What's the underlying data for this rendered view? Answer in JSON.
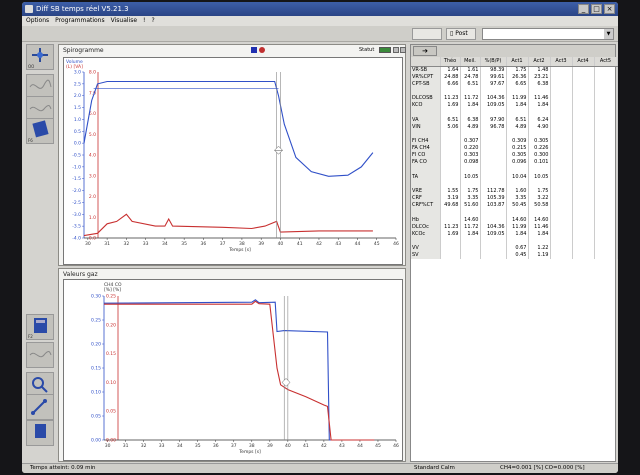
{
  "window": {
    "title": "Diff SB temps réel V5.21.3",
    "menu": [
      "Options",
      "Programmations",
      "Visualise",
      "!",
      "?"
    ],
    "controls": [
      "_",
      "□",
      "×"
    ]
  },
  "toolbar": {
    "tab1": "",
    "tab2": "Post"
  },
  "sidebar": {
    "tools": [
      {
        "label": "OO"
      },
      {
        "label": ""
      },
      {
        "label": ""
      },
      {
        "label": "F6"
      },
      {
        "label": "F2"
      },
      {
        "label": ""
      },
      {
        "label": ""
      },
      {
        "label": ""
      },
      {
        "label": ""
      }
    ]
  },
  "spirogram": {
    "title": "Spirogramme",
    "status_label": "Statut",
    "y_label_1": "Volume",
    "y_label_2": "(L) [VA]",
    "x_label": "Temps [s]",
    "x_ticks": [
      "30",
      "31",
      "32",
      "33",
      "34",
      "35",
      "36",
      "37",
      "38",
      "39",
      "40",
      "41",
      "42",
      "43",
      "44",
      "45",
      "46"
    ],
    "y_ticks_left": [
      "3.0",
      "2.5",
      "2.0",
      "1.5",
      "1.0",
      "0.5",
      "0.0",
      "-0.5",
      "-1.0",
      "-1.5",
      "-2.0",
      "-2.5",
      "-3.0",
      "-3.5",
      "-4.0"
    ],
    "y_ticks_right": [
      "8.0",
      "7.0",
      "6.0",
      "5.0",
      "4.0",
      "3.0",
      "2.0",
      "1.0",
      "0.0"
    ],
    "series": [
      {
        "name": "",
        "color": "#3050c8",
        "points": [
          [
            29.8,
            0
          ],
          [
            30.2,
            1.8
          ],
          [
            30.5,
            2.5
          ],
          [
            31,
            2.6
          ],
          [
            39.7,
            2.6
          ],
          [
            39.9,
            2.0
          ],
          [
            40.2,
            0.8
          ],
          [
            40.8,
            -0.6
          ],
          [
            41.6,
            -1.2
          ],
          [
            42.5,
            -1.4
          ],
          [
            43.5,
            -1.35
          ],
          [
            44.2,
            -1.0
          ],
          [
            44.8,
            -0.4
          ]
        ]
      },
      {
        "name": "",
        "color": "#c83030",
        "points": [
          [
            29.8,
            -3.9
          ],
          [
            30.5,
            -3.8
          ],
          [
            31,
            -3.4
          ],
          [
            31.5,
            -3.3
          ],
          [
            32,
            -3.0
          ],
          [
            32.3,
            -3.3
          ],
          [
            33.5,
            -3.5
          ],
          [
            34,
            -3.5
          ],
          [
            34.2,
            -3.2
          ],
          [
            34.4,
            -3.5
          ],
          [
            37,
            -3.55
          ],
          [
            38.5,
            -3.6
          ],
          [
            39.2,
            -3.5
          ],
          [
            39.8,
            -3.3
          ],
          [
            40,
            -3.75
          ],
          [
            42,
            -3.7
          ],
          [
            44.8,
            -3.7
          ]
        ]
      }
    ],
    "ref_line_value": 2.3
  },
  "gas": {
    "title": "Valeurs gaz",
    "legend_1": "CH4  CO",
    "legend_2": "[%]  [%]",
    "x_label": "Temps [s]",
    "x_ticks": [
      "30",
      "31",
      "32",
      "33",
      "34",
      "35",
      "36",
      "37",
      "38",
      "39",
      "40",
      "41",
      "42",
      "43",
      "44",
      "45",
      "46"
    ],
    "y_ticks_left": [
      "0.30",
      "0.25",
      "0.20",
      "0.15",
      "0.10",
      "0.05",
      "0.00"
    ],
    "y_ticks_right": [
      "0.25",
      "0.20",
      "0.15",
      "0.10",
      "0.05",
      "0.00"
    ],
    "series": [
      {
        "name": "CH4",
        "color": "#3050c8",
        "points": [
          [
            29.8,
            0.285
          ],
          [
            38,
            0.287
          ],
          [
            38.2,
            0.292
          ],
          [
            38.4,
            0.286
          ],
          [
            39.3,
            0.287
          ],
          [
            39.4,
            0.226
          ],
          [
            39.8,
            0.228
          ],
          [
            42.2,
            0.225
          ],
          [
            42.3,
            0.0
          ],
          [
            44.8,
            0.0
          ]
        ]
      },
      {
        "name": "CO",
        "color": "#c83030",
        "points": [
          [
            29.8,
            0.283
          ],
          [
            38,
            0.283
          ],
          [
            38.2,
            0.289
          ],
          [
            38.4,
            0.284
          ],
          [
            39,
            0.283
          ],
          [
            39.4,
            0.15
          ],
          [
            39.6,
            0.115
          ],
          [
            40,
            0.105
          ],
          [
            41,
            0.09
          ],
          [
            42,
            0.073
          ],
          [
            42.2,
            0.07
          ],
          [
            42.4,
            0.0
          ],
          [
            44.8,
            0.0
          ]
        ]
      }
    ]
  },
  "table": {
    "headers": [
      "",
      "Théo",
      "Meil.",
      "%(B/P)",
      "Act1",
      "Act2",
      "Act3",
      "Act4",
      "Act5"
    ],
    "rows": [
      [
        "VR-SB",
        "1.64",
        "1.61",
        "98.39",
        "1.75",
        "1.48",
        "",
        "",
        ""
      ],
      [
        "VR%CPT",
        "24.88",
        "24.78",
        "99.61",
        "26.36",
        "23.21",
        "",
        "",
        ""
      ],
      [
        "CPT-SB",
        "6.66",
        "6.51",
        "97.67",
        "6.65",
        "6.38",
        "",
        "",
        ""
      ],
      [
        "",
        "",
        "",
        "",
        "",
        "",
        "",
        "",
        ""
      ],
      [
        "DLCOSB",
        "11.23",
        "11.72",
        "104.36",
        "11.99",
        "11.46",
        "",
        "",
        ""
      ],
      [
        "KCO",
        "1.69",
        "1.84",
        "109.05",
        "1.84",
        "1.84",
        "",
        "",
        ""
      ],
      [
        "",
        "",
        "",
        "",
        "",
        "",
        "",
        "",
        ""
      ],
      [
        "VA",
        "6.51",
        "6.38",
        "97.90",
        "6.51",
        "6.24",
        "",
        "",
        ""
      ],
      [
        "VIN",
        "5.06",
        "4.89",
        "96.78",
        "4.89",
        "4.90",
        "",
        "",
        ""
      ],
      [
        "",
        "",
        "",
        "",
        "",
        "",
        "",
        "",
        ""
      ],
      [
        "FI CH4",
        "",
        "0.307",
        "",
        "0.309",
        "0.305",
        "",
        "",
        ""
      ],
      [
        "FA CH4",
        "",
        "0.220",
        "",
        "0.215",
        "0.226",
        "",
        "",
        ""
      ],
      [
        "FI CO",
        "",
        "0.303",
        "",
        "0.305",
        "0.300",
        "",
        "",
        ""
      ],
      [
        "FA CO",
        "",
        "0.098",
        "",
        "0.096",
        "0.101",
        "",
        "",
        ""
      ],
      [
        "",
        "",
        "",
        "",
        "",
        "",
        "",
        "",
        ""
      ],
      [
        "TA",
        "",
        "10.05",
        "",
        "10.04",
        "10.05",
        "",
        "",
        ""
      ],
      [
        "",
        "",
        "",
        "",
        "",
        "",
        "",
        "",
        ""
      ],
      [
        "VRE",
        "1.55",
        "1.75",
        "112.78",
        "1.60",
        "1.75",
        "",
        "",
        ""
      ],
      [
        "CRF",
        "3.19",
        "3.35",
        "105.39",
        "3.35",
        "3.22",
        "",
        "",
        ""
      ],
      [
        "CRF%CT",
        "49.68",
        "51.60",
        "103.87",
        "50.45",
        "50.58",
        "",
        "",
        ""
      ],
      [
        "",
        "",
        "",
        "",
        "",
        "",
        "",
        "",
        ""
      ],
      [
        "Hb",
        "",
        "14.60",
        "",
        "14.60",
        "14.60",
        "",
        "",
        ""
      ],
      [
        "DLCOc",
        "11.23",
        "11.72",
        "104.36",
        "11.99",
        "11.46",
        "",
        "",
        ""
      ],
      [
        "KCOc",
        "1.69",
        "1.84",
        "109.05",
        "1.84",
        "1.84",
        "",
        "",
        ""
      ],
      [
        "",
        "",
        "",
        "",
        "",
        "",
        "",
        "",
        ""
      ],
      [
        "VV",
        "",
        "",
        "",
        "0.67",
        "1.22",
        "",
        "",
        ""
      ],
      [
        "SV",
        "",
        "",
        "",
        "0.45",
        "1.19",
        "",
        "",
        ""
      ]
    ]
  },
  "status": {
    "left": "Temps atteint: 0.09 min",
    "middle": "Standard Calm",
    "right": "CH4=0.001 [%] CO=0.000 [%]"
  },
  "colors": {
    "blue": "#3050c8",
    "red": "#c83030",
    "panel_bg": "#f3f3f1"
  }
}
